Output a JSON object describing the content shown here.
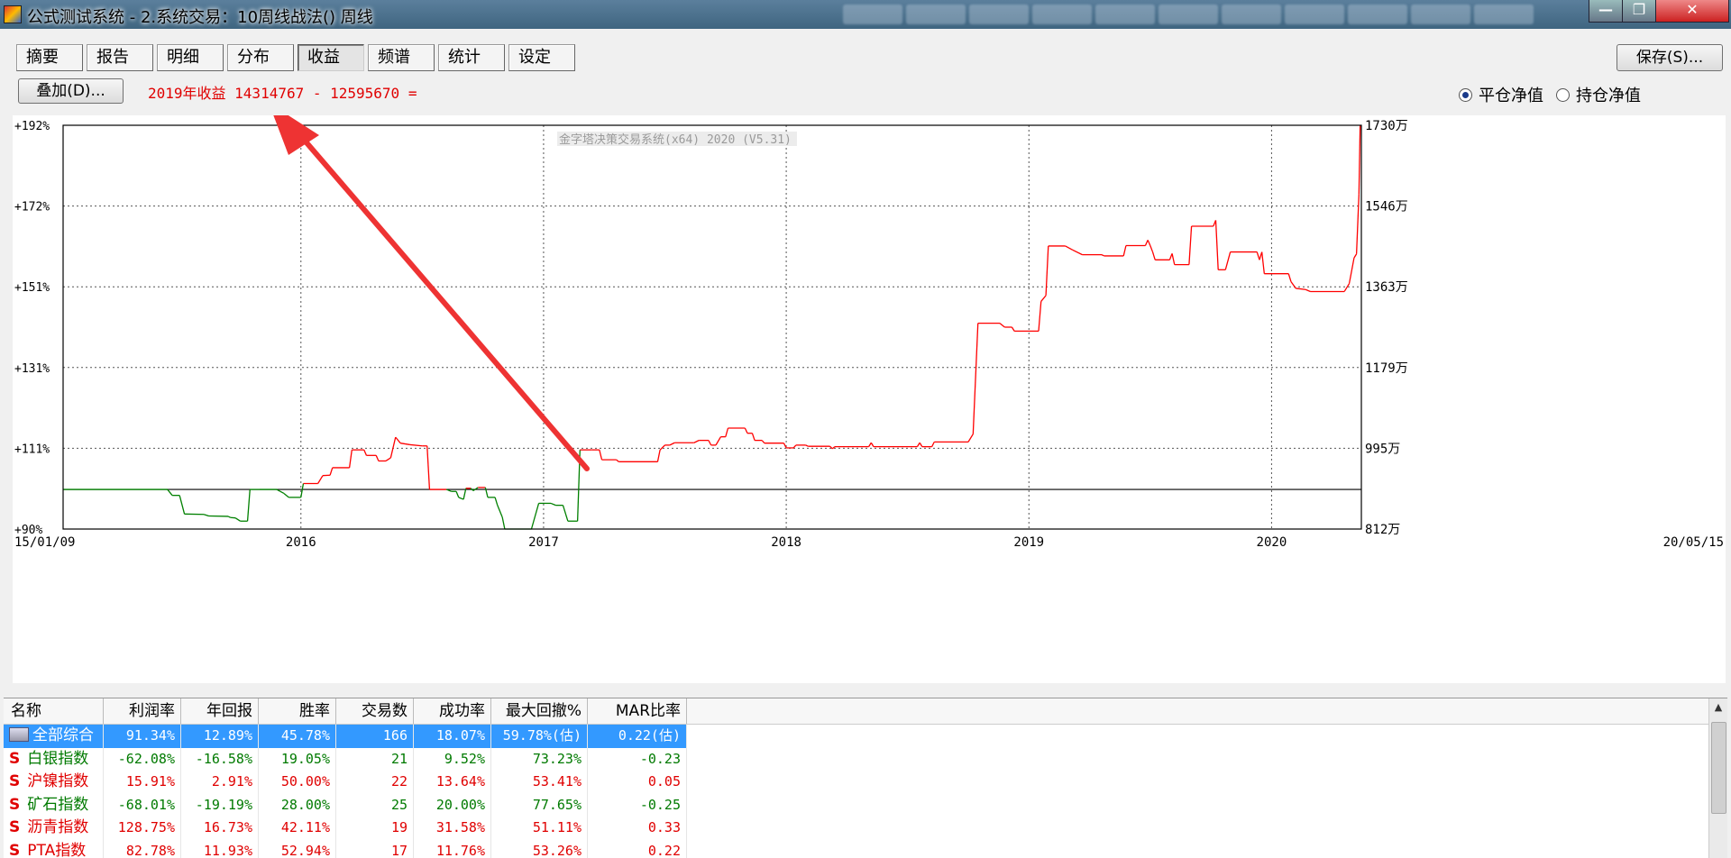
{
  "window": {
    "title": "公式测试系统 - 2.系统交易：10周线战法() 周线",
    "min_icon": "minimize-icon",
    "max_icon": "maximize-icon",
    "close_icon": "close-icon"
  },
  "tabs": [
    {
      "label": "摘要"
    },
    {
      "label": "报告"
    },
    {
      "label": "明细"
    },
    {
      "label": "分布"
    },
    {
      "label": "收益",
      "active": true
    },
    {
      "label": "频谱"
    },
    {
      "label": "统计"
    },
    {
      "label": "设定"
    }
  ],
  "toolbar": {
    "overlay_label": "叠加(D)...",
    "save_label": "保存(S)...",
    "profit_text": "2019年收益 14314767 - 12595670 ="
  },
  "radio": {
    "option1": "平仓净值",
    "option2": "持仓净值",
    "selected": "平仓净值"
  },
  "chart_data": {
    "type": "line",
    "watermark": "金字塔决策交易系统(x64) 2020 (V5.31)",
    "x_range": [
      "15/01/09",
      "20/05/15"
    ],
    "x_ticks": [
      "15/01/09",
      "2016",
      "2017",
      "2018",
      "2019",
      "2020",
      "20/05/15"
    ],
    "x_tick_years": [
      2015.02,
      2016.0,
      2017.0,
      2018.0,
      2019.0,
      2020.0,
      2020.37
    ],
    "y_left_ticks": [
      "+192%",
      "+172%",
      "+151%",
      "+131%",
      "+111%",
      "+90%"
    ],
    "y_left_range": [
      90,
      192
    ],
    "y_right_ticks": [
      "1730万",
      "1546万",
      "1363万",
      "1179万",
      "995万",
      "812万"
    ],
    "baseline": 100,
    "colors": {
      "up": "#ff0000",
      "down": "#008000",
      "baseline": "#000000",
      "arrow": "#ee3333"
    },
    "series": [
      {
        "x": 2015.02,
        "y": 100.0
      },
      {
        "x": 2015.45,
        "y": 100.0
      },
      {
        "x": 2015.47,
        "y": 98.5
      },
      {
        "x": 2015.5,
        "y": 98.5
      },
      {
        "x": 2015.52,
        "y": 93.8
      },
      {
        "x": 2015.6,
        "y": 93.7
      },
      {
        "x": 2015.62,
        "y": 93.3
      },
      {
        "x": 2015.7,
        "y": 93.2
      },
      {
        "x": 2015.71,
        "y": 92.9
      },
      {
        "x": 2015.73,
        "y": 92.8
      },
      {
        "x": 2015.75,
        "y": 92.0
      },
      {
        "x": 2015.78,
        "y": 92.0
      },
      {
        "x": 2015.79,
        "y": 100.0
      },
      {
        "x": 2015.83,
        "y": 100.0
      },
      {
        "x": 2015.9,
        "y": 100.0
      },
      {
        "x": 2015.93,
        "y": 99.0
      },
      {
        "x": 2015.95,
        "y": 98.0
      },
      {
        "x": 2016.0,
        "y": 98.0
      },
      {
        "x": 2016.01,
        "y": 101.5
      },
      {
        "x": 2016.07,
        "y": 101.5
      },
      {
        "x": 2016.09,
        "y": 103.5
      },
      {
        "x": 2016.12,
        "y": 103.6
      },
      {
        "x": 2016.13,
        "y": 105.5
      },
      {
        "x": 2016.2,
        "y": 105.5
      },
      {
        "x": 2016.21,
        "y": 110.0
      },
      {
        "x": 2016.26,
        "y": 110.0
      },
      {
        "x": 2016.27,
        "y": 108.6
      },
      {
        "x": 2016.31,
        "y": 108.6
      },
      {
        "x": 2016.32,
        "y": 107.2
      },
      {
        "x": 2016.35,
        "y": 107.2
      },
      {
        "x": 2016.37,
        "y": 108.0
      },
      {
        "x": 2016.39,
        "y": 113.2
      },
      {
        "x": 2016.41,
        "y": 111.7
      },
      {
        "x": 2016.43,
        "y": 111.5
      },
      {
        "x": 2016.45,
        "y": 111.3
      },
      {
        "x": 2016.5,
        "y": 111.0
      },
      {
        "x": 2016.52,
        "y": 111.0
      },
      {
        "x": 2016.53,
        "y": 100.0
      },
      {
        "x": 2016.6,
        "y": 100.0
      },
      {
        "x": 2016.62,
        "y": 99.5
      },
      {
        "x": 2016.64,
        "y": 99.5
      },
      {
        "x": 2016.65,
        "y": 98.0
      },
      {
        "x": 2016.67,
        "y": 97.5
      },
      {
        "x": 2016.68,
        "y": 100.3
      },
      {
        "x": 2016.7,
        "y": 100.3
      },
      {
        "x": 2016.71,
        "y": 99.7
      },
      {
        "x": 2016.73,
        "y": 100.5
      },
      {
        "x": 2016.76,
        "y": 100.5
      },
      {
        "x": 2016.77,
        "y": 98.0
      },
      {
        "x": 2016.8,
        "y": 98.0
      },
      {
        "x": 2016.81,
        "y": 96.0
      },
      {
        "x": 2016.83,
        "y": 93.0
      },
      {
        "x": 2016.84,
        "y": 90.0
      },
      {
        "x": 2016.95,
        "y": 90.0
      },
      {
        "x": 2016.98,
        "y": 96.5
      },
      {
        "x": 2017.03,
        "y": 96.5
      },
      {
        "x": 2017.05,
        "y": 96.0
      },
      {
        "x": 2017.08,
        "y": 96.0
      },
      {
        "x": 2017.1,
        "y": 92.0
      },
      {
        "x": 2017.14,
        "y": 92.0
      },
      {
        "x": 2017.15,
        "y": 110.0
      },
      {
        "x": 2017.2,
        "y": 110.0
      },
      {
        "x": 2017.23,
        "y": 110.0
      },
      {
        "x": 2017.24,
        "y": 107.5
      },
      {
        "x": 2017.3,
        "y": 107.5
      },
      {
        "x": 2017.31,
        "y": 107.0
      },
      {
        "x": 2017.47,
        "y": 107.0
      },
      {
        "x": 2017.48,
        "y": 110.0
      },
      {
        "x": 2017.5,
        "y": 111.2
      },
      {
        "x": 2017.52,
        "y": 111.2
      },
      {
        "x": 2017.54,
        "y": 111.8
      },
      {
        "x": 2017.62,
        "y": 111.8
      },
      {
        "x": 2017.64,
        "y": 112.4
      },
      {
        "x": 2017.68,
        "y": 112.4
      },
      {
        "x": 2017.69,
        "y": 111.2
      },
      {
        "x": 2017.71,
        "y": 111.2
      },
      {
        "x": 2017.73,
        "y": 113.3
      },
      {
        "x": 2017.75,
        "y": 113.3
      },
      {
        "x": 2017.76,
        "y": 115.5
      },
      {
        "x": 2017.83,
        "y": 115.5
      },
      {
        "x": 2017.84,
        "y": 114.2
      },
      {
        "x": 2017.86,
        "y": 114.2
      },
      {
        "x": 2017.87,
        "y": 112.4
      },
      {
        "x": 2017.9,
        "y": 112.4
      },
      {
        "x": 2017.91,
        "y": 111.7
      },
      {
        "x": 2017.99,
        "y": 111.7
      },
      {
        "x": 2018.0,
        "y": 110.5
      },
      {
        "x": 2018.03,
        "y": 110.5
      },
      {
        "x": 2018.04,
        "y": 111.2
      },
      {
        "x": 2018.08,
        "y": 111.2
      },
      {
        "x": 2018.09,
        "y": 110.9
      },
      {
        "x": 2018.18,
        "y": 110.9
      },
      {
        "x": 2018.19,
        "y": 110.3
      },
      {
        "x": 2018.2,
        "y": 110.8
      },
      {
        "x": 2018.34,
        "y": 110.8
      },
      {
        "x": 2018.35,
        "y": 111.8
      },
      {
        "x": 2018.36,
        "y": 110.8
      },
      {
        "x": 2018.54,
        "y": 110.8
      },
      {
        "x": 2018.55,
        "y": 111.8
      },
      {
        "x": 2018.56,
        "y": 110.8
      },
      {
        "x": 2018.6,
        "y": 110.8
      },
      {
        "x": 2018.61,
        "y": 112.0
      },
      {
        "x": 2018.75,
        "y": 112.0
      },
      {
        "x": 2018.77,
        "y": 114.0
      },
      {
        "x": 2018.79,
        "y": 142.0
      },
      {
        "x": 2018.88,
        "y": 142.0
      },
      {
        "x": 2018.9,
        "y": 141.0
      },
      {
        "x": 2018.93,
        "y": 141.0
      },
      {
        "x": 2018.94,
        "y": 140.0
      },
      {
        "x": 2019.04,
        "y": 140.0
      },
      {
        "x": 2019.05,
        "y": 147.5
      },
      {
        "x": 2019.07,
        "y": 149.0
      },
      {
        "x": 2019.08,
        "y": 161.5
      },
      {
        "x": 2019.15,
        "y": 161.5
      },
      {
        "x": 2019.18,
        "y": 160.5
      },
      {
        "x": 2019.22,
        "y": 159.3
      },
      {
        "x": 2019.3,
        "y": 159.3
      },
      {
        "x": 2019.31,
        "y": 159.0
      },
      {
        "x": 2019.39,
        "y": 159.0
      },
      {
        "x": 2019.4,
        "y": 161.6
      },
      {
        "x": 2019.48,
        "y": 161.6
      },
      {
        "x": 2019.49,
        "y": 163.0
      },
      {
        "x": 2019.5,
        "y": 161.6
      },
      {
        "x": 2019.51,
        "y": 160.0
      },
      {
        "x": 2019.52,
        "y": 158.0
      },
      {
        "x": 2019.58,
        "y": 158.0
      },
      {
        "x": 2019.59,
        "y": 159.6
      },
      {
        "x": 2019.6,
        "y": 156.8
      },
      {
        "x": 2019.66,
        "y": 156.8
      },
      {
        "x": 2019.67,
        "y": 166.5
      },
      {
        "x": 2019.76,
        "y": 166.5
      },
      {
        "x": 2019.77,
        "y": 168.0
      },
      {
        "x": 2019.78,
        "y": 155.5
      },
      {
        "x": 2019.81,
        "y": 155.5
      },
      {
        "x": 2019.83,
        "y": 160.0
      },
      {
        "x": 2019.94,
        "y": 160.0
      },
      {
        "x": 2019.95,
        "y": 158.0
      },
      {
        "x": 2019.96,
        "y": 160.0
      },
      {
        "x": 2019.97,
        "y": 154.5
      },
      {
        "x": 2020.07,
        "y": 154.5
      },
      {
        "x": 2020.08,
        "y": 152.5
      },
      {
        "x": 2020.1,
        "y": 150.8
      },
      {
        "x": 2020.14,
        "y": 150.5
      },
      {
        "x": 2020.16,
        "y": 150.0
      },
      {
        "x": 2020.3,
        "y": 150.0
      },
      {
        "x": 2020.32,
        "y": 152.0
      },
      {
        "x": 2020.34,
        "y": 158.5
      },
      {
        "x": 2020.35,
        "y": 159.5
      },
      {
        "x": 2020.36,
        "y": 174.5
      },
      {
        "x": 2020.365,
        "y": 192.0
      }
    ]
  },
  "table": {
    "columns": [
      "名称",
      "利润率",
      "年回报",
      "胜率",
      "交易数",
      "成功率",
      "最大回撤%",
      "MAR比率"
    ],
    "rows": [
      {
        "name": "全部综合",
        "type": "folder",
        "selected": true,
        "cells": [
          "91.34%",
          "12.89%",
          "45.78%",
          "166",
          "18.07%",
          "59.78%(估)",
          "0.22(估)"
        ],
        "color": "red"
      },
      {
        "name": "白银指数",
        "type": "S",
        "cells": [
          "-62.08%",
          "-16.58%",
          "19.05%",
          "21",
          "9.52%",
          "73.23%",
          "-0.23"
        ],
        "color": "green"
      },
      {
        "name": "沪镍指数",
        "type": "S",
        "cells": [
          "15.91%",
          "2.91%",
          "50.00%",
          "22",
          "13.64%",
          "53.41%",
          "0.05"
        ],
        "color": "red"
      },
      {
        "name": "矿石指数",
        "type": "S",
        "cells": [
          "-68.01%",
          "-19.19%",
          "28.00%",
          "25",
          "20.00%",
          "77.65%",
          "-0.25"
        ],
        "color": "green"
      },
      {
        "name": "沥青指数",
        "type": "S",
        "cells": [
          "128.75%",
          "16.73%",
          "42.11%",
          "19",
          "31.58%",
          "51.11%",
          "0.33"
        ],
        "color": "red"
      },
      {
        "name": "PTA指数",
        "type": "S",
        "cells": [
          "82.78%",
          "11.93%",
          "52.94%",
          "17",
          "11.76%",
          "53.26%",
          "0.22"
        ],
        "color": "red"
      }
    ]
  }
}
